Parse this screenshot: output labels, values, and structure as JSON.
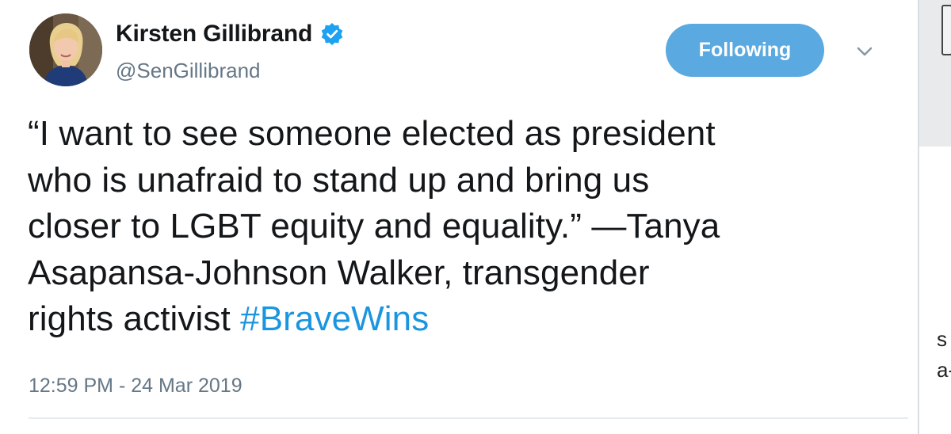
{
  "tweet": {
    "display_name": "Kirsten Gillibrand",
    "handle": "@SenGillibrand",
    "follow_button_label": "Following",
    "text_lines": [
      "“I want to see someone elected as president",
      "who is unafraid to stand up and bring us",
      "closer to LGBT equity and equality.” —Tanya",
      "Asapansa-Johnson Walker, transgender"
    ],
    "last_line_text": "rights activist ",
    "hashtag": "#BraveWins",
    "timestamp": "12:59 PM - 24 Mar 2019",
    "icons": {
      "verified": "verified-badge-icon",
      "caret": "chevron-down-icon"
    }
  },
  "side_panel": {
    "fragments": [
      "s",
      "a-"
    ]
  },
  "colors": {
    "text": "#14171a",
    "secondary_text": "#657786",
    "follow_button_bg": "#5aa9e0",
    "hashtag": "#1b95e0",
    "verified_badge": "#1da1f2"
  }
}
